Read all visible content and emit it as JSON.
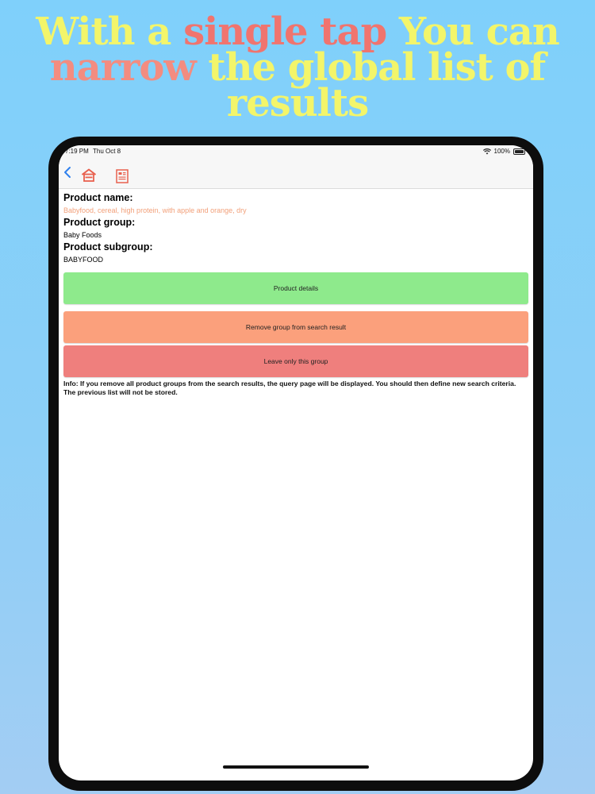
{
  "headline": {
    "line1_a": "With a ",
    "line1_b": "single tap",
    "line1_c": " You can",
    "line2_a": "narrow",
    "line2_b": " the global list of",
    "line3": "results"
  },
  "status_bar": {
    "time": "7:19 PM",
    "date": "Thu Oct 8",
    "battery": "100%"
  },
  "product": {
    "name_label": "Product name:",
    "name_value": "Babyfood, cereal, high protein, with apple and orange, dry",
    "group_label": "Product group:",
    "group_value": "Baby Foods",
    "subgroup_label": "Product subgroup:",
    "subgroup_value": "BABYFOOD"
  },
  "buttons": {
    "details": "Product details",
    "remove_group": "Remove group from search result",
    "leave_group": "Leave only this group"
  },
  "info_text": "Info: If you remove all product groups from the search results, the query page will be displayed. You should then define new search criteria. The previous list will not be stored.",
  "icons": {
    "back": "chevron-left-icon",
    "home": "home-icon",
    "list": "document-list-icon",
    "wifi": "wifi-icon",
    "battery": "battery-icon"
  },
  "colors": {
    "background": "#7fd0fb",
    "headline_yellow": "#f3f56a",
    "headline_red": "#f0746e",
    "accent_blue": "#2f80ed",
    "icon_red": "#e8614f",
    "btn_green": "#8eea8c",
    "btn_orange": "#fba07c",
    "btn_red": "#ef7f7d",
    "name_value_orange": "#f2a07a"
  }
}
